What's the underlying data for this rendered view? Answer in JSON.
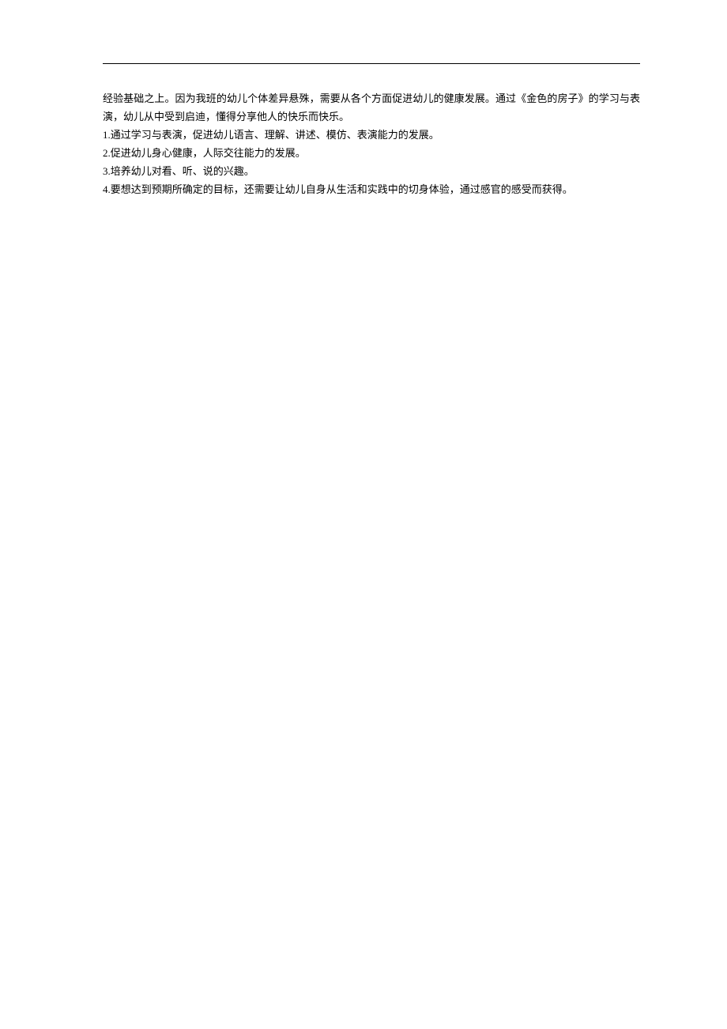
{
  "body": {
    "paragraph": "经验基础之上。因为我班的幼儿个体差异悬殊，需要从各个方面促进幼儿的健康发展。通过《金色的房子》的学习与表演，幼儿从中受到启迪，懂得分享他人的快乐而快乐。",
    "items": [
      "1.通过学习与表演，促进幼儿语言、理解、讲述、模仿、表演能力的发展。",
      "2.促进幼儿身心健康，人际交往能力的发展。",
      "3.培养幼儿对看、听、说的兴趣。",
      "4.要想达到预期所确定的目标，还需要让幼儿自身从生活和实践中的切身体验，通过感官的感受而获得。"
    ]
  }
}
